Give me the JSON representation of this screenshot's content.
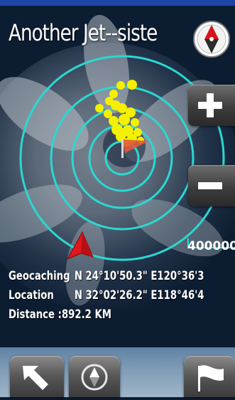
{
  "title": "Another Jet--sister caches",
  "scale_label": "400000",
  "info": {
    "geocaching_label": "Geocaching",
    "geocaching_value": "N 24°10'50.3\" E120°36'3",
    "location_label": "Location",
    "location_value": "N 32°02'26.2\" E118°46'4",
    "distance_text": "Distance :892.2 KM"
  },
  "colors": {
    "ring": "#2ad8d2",
    "cache_dot": "#f4f000",
    "heading_arrow": "#e2171c",
    "bottom_bar": "#7d9ab5"
  },
  "icons": {
    "compass": "compass-icon",
    "zoom_in": "plus-icon",
    "zoom_out": "minus-icon",
    "back": "back-arrow-icon",
    "center": "compass-small-icon",
    "flag": "flag-icon"
  }
}
